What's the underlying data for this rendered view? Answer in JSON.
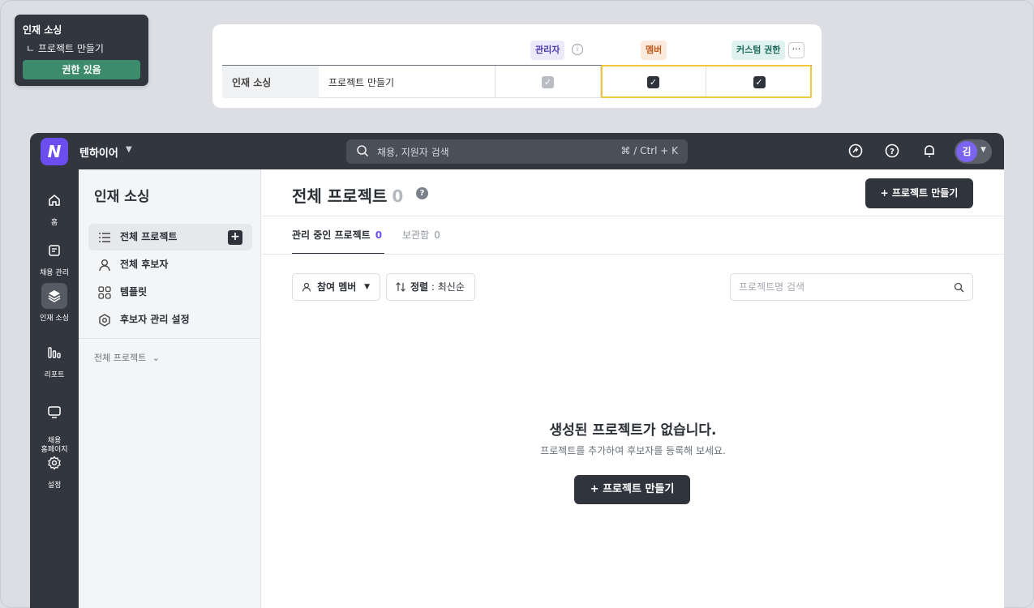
{
  "tooltip": {
    "title": "인재 소싱",
    "subtitle": "ㄴ 프로젝트 만들기",
    "badge": "권한 있음"
  },
  "permission_table": {
    "roles": {
      "admin": "관리자",
      "member": "멤버",
      "custom": "커스텀 권한"
    },
    "more_label": "···",
    "row": {
      "category": "인재 소싱",
      "action": "프로젝트 만들기",
      "admin_checked": true,
      "member_checked": true,
      "custom_checked": true
    },
    "highlight_color": "#f2c83a"
  },
  "topbar": {
    "company": "텐하이어",
    "search_placeholder": "채용, 지원자 검색",
    "search_shortcut": "⌘ / Ctrl + K",
    "avatar_initial": "김",
    "icons": [
      "chat-icon",
      "help-icon",
      "bell-icon"
    ]
  },
  "rail": {
    "items": [
      {
        "label": "홈",
        "icon": "home-icon"
      },
      {
        "label": "채용 관리",
        "icon": "document-icon"
      },
      {
        "label": "인재 소싱",
        "icon": "layers-icon",
        "active": true
      },
      {
        "label": "리포트",
        "icon": "bar-chart-icon"
      },
      {
        "label": "채용\n홈페이지",
        "icon": "monitor-icon"
      },
      {
        "label": "설정",
        "icon": "gear-icon"
      }
    ]
  },
  "sidebar": {
    "title": "인재 소싱",
    "items": [
      {
        "label": "전체 프로젝트",
        "icon": "list-icon",
        "active": true
      },
      {
        "label": "전체 후보자",
        "icon": "person-icon"
      },
      {
        "label": "템플릿",
        "icon": "grid-icon"
      },
      {
        "label": "후보자 관리 설정",
        "icon": "hexagon-gear-icon"
      }
    ],
    "filter_label": "전체 프로젝트"
  },
  "main": {
    "title": "전체 프로젝트",
    "count": "0",
    "create_button": "+ 프로젝트 만들기",
    "tabs": [
      {
        "label": "관리 중인 프로젝트",
        "count": "0"
      },
      {
        "label": "보관함",
        "count": "0"
      }
    ],
    "member_filter": "참여 멤버",
    "sort_label": "정렬",
    "sort_value": " : 최신순",
    "project_search_placeholder": "프로젝트명 검색",
    "empty_title": "생성된 프로젝트가 없습니다.",
    "empty_subtitle": "프로젝트를 추가하여 후보자를 등록해 보세요.",
    "empty_create_button": "+ 프로젝트 만들기"
  },
  "colors": {
    "accent": "#6c4df0",
    "dark": "#32363f",
    "badge_green": "#3c8b6c"
  }
}
